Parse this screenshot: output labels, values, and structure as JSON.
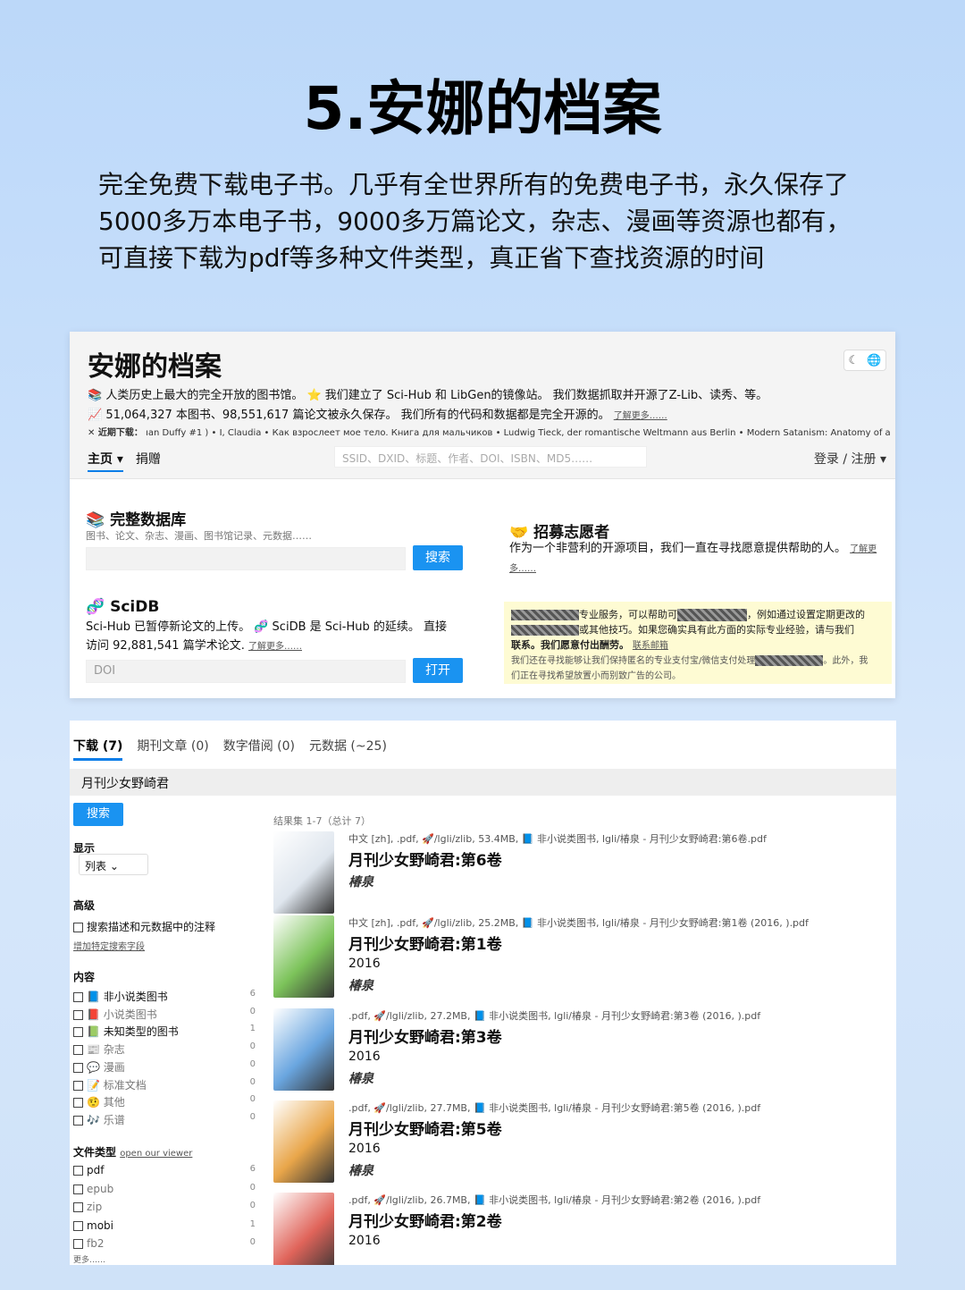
{
  "title": "5.安娜的档案",
  "desc": "完全免费下载电子书。几乎有全世界所有的免费电子书，永久保存了5000多万本电子书，9000多万篇论文，杂志、漫画等资源也都有，可直接下载为pdf等多种文件类型，真正省下查找资源的时间",
  "site": {
    "name": "安娜的档案",
    "line1": "📚 人类历史上最大的完全开放的图书馆。 ⭐ 我们建立了 Sci-Hub 和 LibGen的镜像站。 我们数据抓取并开源了Z-Lib、读秀、等。",
    "line2": "📈 51,064,327 本图书、98,551,617 篇论文被永久保存。 我们所有的代码和数据都是完全开源的。",
    "line2_link": "了解更多……",
    "recent_label": "✕ 近期下载：",
    "recent": "ıan Duffy #1 ) • I, Claudia • Как взрослеет мое тело. Книга для мальчиков • Ludwig Tieck, der romantische Weltmann aus Berlin • Modern Satanism: Anatomy of a Rad",
    "nav_home": "主页 ▾",
    "nav_donate": "捐赠",
    "search_placeholder": "SSID、DXID、标题、作者、DOI、ISBN、MD5……",
    "login": "登录 / 注册 ▾",
    "moon_icon": "☾",
    "globe_icon": "🌐"
  },
  "db": {
    "title": "📚 完整数据库",
    "sub": "图书、论文、杂志、漫画、图书馆记录、元数据……",
    "btn": "搜索"
  },
  "scidb": {
    "title": "🧬 SciDB",
    "text1": "Sci-Hub 已暂停新论文的上传。 🧬 SciDB 是 Sci-Hub 的延续。 直接",
    "text2": "访问 92,881,541 篇学术论文.",
    "link": "了解更多……",
    "placeholder": "DOI",
    "btn": "打开"
  },
  "volunteer": {
    "title": "🤝 招募志愿者",
    "text": "作为一个非营利的开源项目，我们一直在寻找愿意提供帮助的人。",
    "link": "了解更多……"
  },
  "ad": {
    "l1": "专业服务，可以帮助可",
    "l1b": "，例如通过设置定期更改的",
    "l2": "或其他技巧。如果您确实具有此方面的实际专业经验，请与我们",
    "l3": "联系。我们愿意付出酬劳。",
    "l3_link": "联系邮箱",
    "l4": "我们还在寻找能够让我们保持匿名的专业支付宝/微信支付处理",
    "l4b": "。此外，我",
    "l5": "们正在寻找希望放置小而别致广告的公司。"
  },
  "tabs": [
    "下载 (7)",
    "期刊文章 (0)",
    "数字借阅 (0)",
    "元数据 (~25)"
  ],
  "query": "月刊少女野崎君",
  "side": {
    "search_btn": "搜索",
    "display_label": "显示",
    "display_value": "列表 ⌄",
    "advanced_label": "高级",
    "advanced_check": "搜索描述和元数据中的注释",
    "advanced_link": "增加特定搜索字段",
    "content_label": "内容",
    "content": [
      {
        "label": "📘 非小说类图书",
        "count": "6",
        "muted": false
      },
      {
        "label": "📕 小说类图书",
        "count": "0",
        "muted": true
      },
      {
        "label": "📗 未知类型的图书",
        "count": "1",
        "muted": false
      },
      {
        "label": "📰 杂志",
        "count": "0",
        "muted": true
      },
      {
        "label": "💬 漫画",
        "count": "0",
        "muted": true
      },
      {
        "label": "📝 标准文档",
        "count": "0",
        "muted": true
      },
      {
        "label": "🤨 其他",
        "count": "0",
        "muted": true
      },
      {
        "label": "🎶 乐谱",
        "count": "0",
        "muted": true
      }
    ],
    "filetype_label": "文件类型",
    "filetype_link": "open our viewer",
    "filetypes": [
      {
        "label": "pdf",
        "count": "6",
        "muted": false
      },
      {
        "label": "epub",
        "count": "0",
        "muted": true
      },
      {
        "label": "zip",
        "count": "0",
        "muted": true
      },
      {
        "label": "mobi",
        "count": "1",
        "muted": false
      },
      {
        "label": "fb2",
        "count": "0",
        "muted": true
      }
    ],
    "more": "更多……"
  },
  "results_count": "结果集 1-7（总计 7）",
  "results": [
    {
      "meta": "中文 [zh], .pdf, 🚀/lgli/zlib, 53.4MB, 📘 非小说类图书, lgli/椿泉 - 月刊少女野崎君:第6卷.pdf",
      "title": "月刊少女野崎君:第6卷",
      "year": "",
      "author": "椿泉",
      "color": "#dfe6ee"
    },
    {
      "meta": "中文 [zh], .pdf, 🚀/lgli/zlib, 25.2MB, 📘 非小说类图书, lgli/椿泉 - 月刊少女野崎君:第1卷 (2016, ).pdf",
      "title": "月刊少女野崎君:第1卷",
      "year": "2016",
      "author": "椿泉",
      "color": "#7cc35a"
    },
    {
      "meta": ".pdf, 🚀/lgli/zlib, 27.2MB, 📘 非小说类图书, lgli/椿泉 - 月刊少女野崎君:第3卷 (2016, ).pdf",
      "title": "月刊少女野崎君:第3卷",
      "year": "2016",
      "author": "椿泉",
      "color": "#6aa6e0"
    },
    {
      "meta": ".pdf, 🚀/lgli/zlib, 27.7MB, 📘 非小说类图书, lgli/椿泉 - 月刊少女野崎君:第5卷 (2016, ).pdf",
      "title": "月刊少女野崎君:第5卷",
      "year": "2016",
      "author": "椿泉",
      "color": "#e9a64a"
    },
    {
      "meta": ".pdf, 🚀/lgli/zlib, 26.7MB, 📘 非小说类图书, lgli/椿泉 - 月刊少女野崎君:第2卷 (2016, ).pdf",
      "title": "月刊少女野崎君:第2卷",
      "year": "2016",
      "author": "",
      "color": "#e0645a"
    }
  ]
}
